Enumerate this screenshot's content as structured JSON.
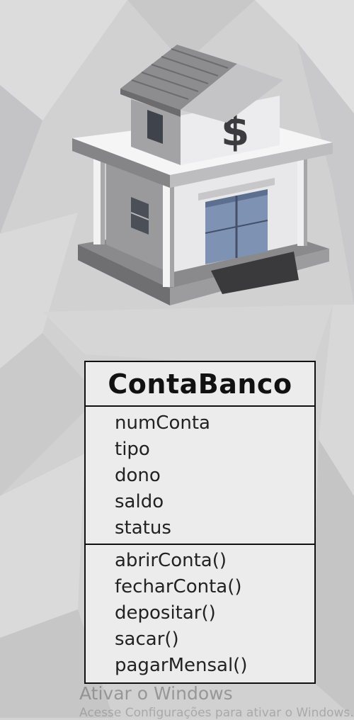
{
  "uml_class": {
    "name": "ContaBanco",
    "attributes": [
      "numConta",
      "tipo",
      "dono",
      "saldo",
      "status"
    ],
    "methods": [
      "abrirConta()",
      "fecharConta()",
      "depositar()",
      "sacar()",
      "pagarMensal()"
    ]
  },
  "illustration": {
    "icon": "bank-building-icon",
    "symbol": "$"
  },
  "watermark": {
    "line1": "Ativar o Windows",
    "line2": "Acesse Configurações para ativar o Windows."
  }
}
